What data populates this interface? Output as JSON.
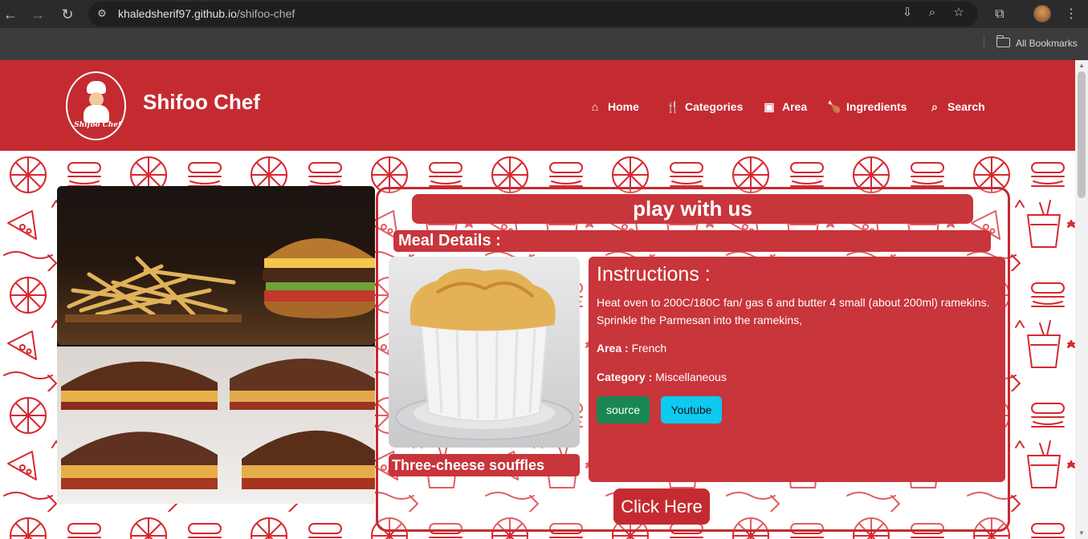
{
  "browser": {
    "url_host": "khaledsherif97.github.io",
    "url_path": "/shifoo-chef",
    "bookmarks_label": "All Bookmarks"
  },
  "site": {
    "logo_text": "Shifoo Chef",
    "brand": "Shifoo Chef",
    "nav": [
      {
        "label": "Home",
        "icon": "home-icon"
      },
      {
        "label": "Categories",
        "icon": "utensils-icon"
      },
      {
        "label": "Area",
        "icon": "map-icon"
      },
      {
        "label": "Ingredients",
        "icon": "drumstick-icon"
      },
      {
        "label": "Search",
        "icon": "search-icon"
      }
    ],
    "header_color": "#c42b31"
  },
  "panel": {
    "banner": "play with us",
    "details_title": "Meal Details :",
    "meal_name": "Three-cheese souffles",
    "instructions_title": "Instructions :",
    "instructions_text": "Heat oven to 200C/180C fan/ gas 6 and butter 4 small (about 200ml) ramekins. Sprinkle the Parmesan into the ramekins,",
    "area_label": "Area :",
    "area_value": "French",
    "category_label": "Category :",
    "category_value": "Miscellaneous",
    "source_button": "source",
    "youtube_button": "Youtube",
    "click_button": "Click Here"
  }
}
